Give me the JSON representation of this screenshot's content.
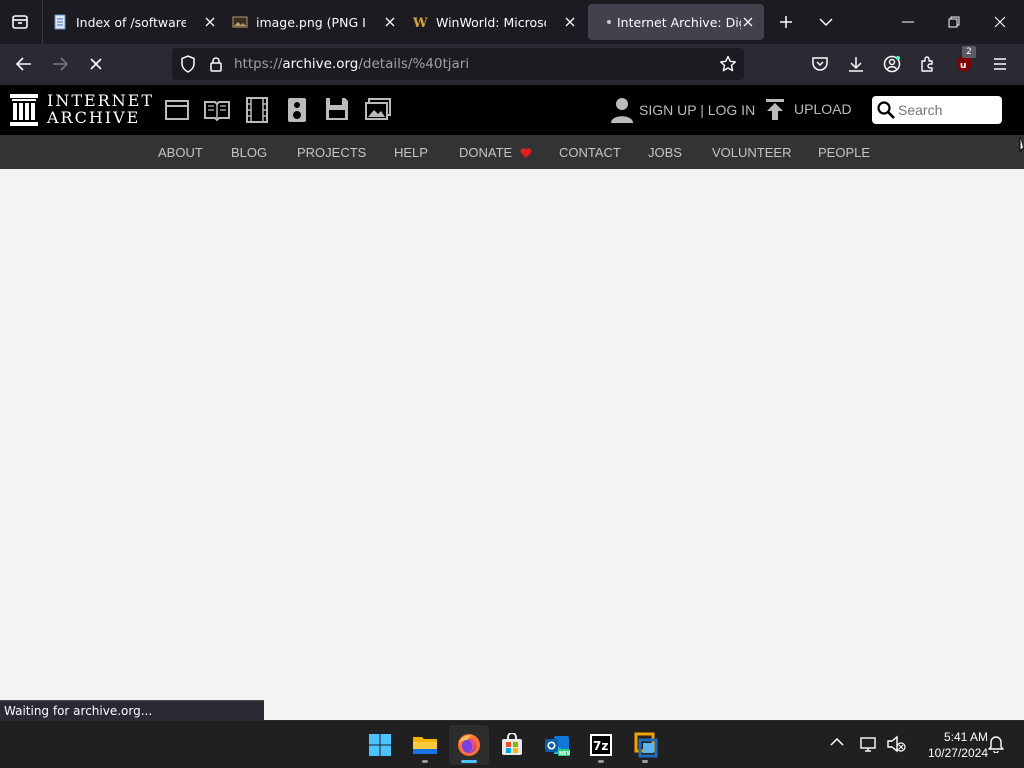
{
  "browser": {
    "tabs": [
      {
        "title": "Index of /software/",
        "favicon": "document-icon"
      },
      {
        "title": "image.png (PNG Image, ...",
        "favicon": "image-icon"
      },
      {
        "title": "WinWorld: Microsoft W",
        "favicon": "winworld-icon"
      },
      {
        "title": "Internet Archive: Digital",
        "favicon": "loading-dot",
        "active": true
      }
    ],
    "url_prefix": "https://",
    "url_domain": "archive.org",
    "url_path": "/details/%40tjari",
    "extension_badge": "2",
    "status": "Waiting for archive.org..."
  },
  "ia": {
    "logo_line1": "INTERNET",
    "logo_line2": "ARCHIVE",
    "media_icons": [
      "web-icon",
      "texts-icon",
      "video-icon",
      "audio-icon",
      "software-icon",
      "images-icon"
    ],
    "signup_label": "SIGN UP | LOG IN",
    "upload_label": "UPLOAD",
    "search_placeholder": "Search",
    "menu": [
      "ABOUT",
      "BLOG",
      "PROJECTS",
      "HELP",
      "DONATE",
      "CONTACT",
      "JOBS",
      "VOLUNTEER",
      "PEOPLE"
    ]
  },
  "taskbar": {
    "time": "5:41 AM",
    "date": "10/27/2024"
  },
  "colors": {
    "accent": "#4cc2ff",
    "donate_heart": "#e02020",
    "ia_black": "#000000",
    "ia_menu": "#333333"
  }
}
